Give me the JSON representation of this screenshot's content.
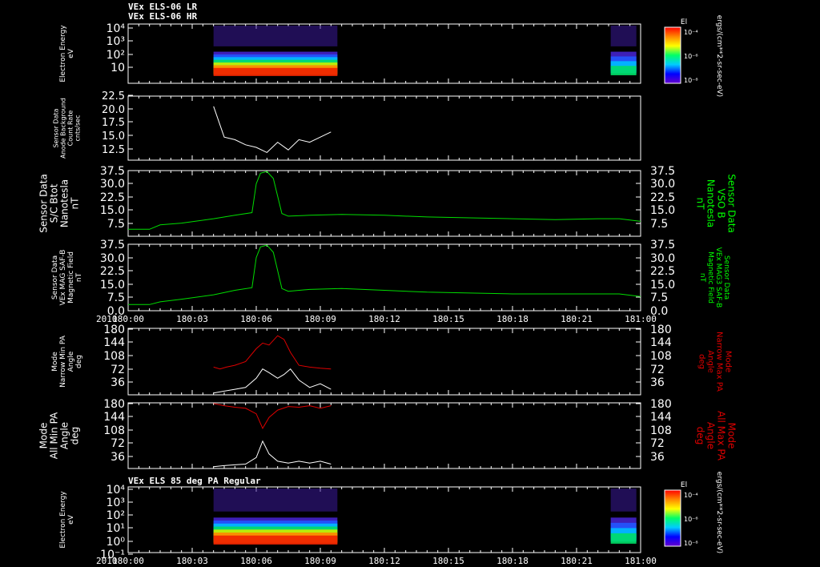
{
  "header": {
    "title_line1": "VEx ELS-06 LR",
    "title_line2": "VEx ELS-06 HR",
    "bottom_title": "VEx ELS 85 deg PA Regular"
  },
  "colors": {
    "background": "#000000",
    "axis": "#ffffff",
    "green": "#00dd00",
    "label_green": "#00ff00",
    "red": "#dd0000",
    "white_trace": "#ffffff"
  },
  "colorbar": {
    "label": "El",
    "ticks": [
      "10⁻⁴",
      "10⁻⁶",
      "10⁻⁸"
    ],
    "unit": "ergs/(cm**2-sr-sec-eV)"
  },
  "time_axis": {
    "year": "2010",
    "ticks": [
      "180:00",
      "180:03",
      "180:06",
      "180:09",
      "180:12",
      "180:15",
      "180:18",
      "180:21",
      "181:00"
    ]
  },
  "chart_data": [
    {
      "type": "heatmap",
      "ylabel": "Electron Energy\neV",
      "y_scale": "log",
      "ylim": [
        1,
        10000
      ],
      "yticks": [
        "10⁴",
        "10³",
        "10²",
        "10"
      ],
      "coverage": [
        [
          "180:04.0",
          "180:09.8"
        ],
        [
          "180:22.6",
          "180:23.8"
        ]
      ]
    },
    {
      "type": "line",
      "ylabel": "Sensor Data\nAnode Background\nCount Rate\ncnts/sec",
      "ylim": [
        10,
        22.5
      ],
      "yticks": [
        "22.5",
        "20.0",
        "17.5",
        "15.0",
        "12.5"
      ],
      "series": [
        {
          "color": "white",
          "x": [
            "180:04.0",
            "180:04.5",
            "180:05.0",
            "180:05.5",
            "180:06.0",
            "180:06.5",
            "180:07.0",
            "180:07.5",
            "180:08.0",
            "180:08.5",
            "180:09.0",
            "180:09.5"
          ],
          "y": [
            20.5,
            14.5,
            14.0,
            13.0,
            12.5,
            11.5,
            13.5,
            12.0,
            14.0,
            13.5,
            14.5,
            15.5
          ]
        }
      ]
    },
    {
      "type": "line",
      "ylabel": "Sensor Data\nS/C Btot\nNanotesla\nnT",
      "ylabel_right": "Sensor Data\nVSO B\nNanotesla\nnT",
      "ylim": [
        0,
        37.5
      ],
      "yticks": [
        "37.5",
        "30.0",
        "22.5",
        "15.0",
        "7.5"
      ],
      "series": [
        {
          "color": "green",
          "x": [
            "180:00.0",
            "180:01.0",
            "180:01.5",
            "180:02.5",
            "180:04.0",
            "180:05.0",
            "180:05.8",
            "180:06.0",
            "180:06.2",
            "180:06.5",
            "180:06.8",
            "180:07.2",
            "180:07.5",
            "180:08.5",
            "180:10.0",
            "180:12.0",
            "180:14.0",
            "180:16.0",
            "180:18.0",
            "180:20.0",
            "180:22.0",
            "180:23.0",
            "180:24.0"
          ],
          "y": [
            4.0,
            4.0,
            6.5,
            7.5,
            10.0,
            12.0,
            13.5,
            30.0,
            36.0,
            37.0,
            33.0,
            13.0,
            11.5,
            12.0,
            12.5,
            12.0,
            11.0,
            10.5,
            10.0,
            9.5,
            10.0,
            10.0,
            8.5
          ]
        }
      ]
    },
    {
      "type": "line",
      "ylabel": "Sensor Data\nVEx MAG SAF-B\nMagnetic Field\nnT",
      "ylabel_right": "Sensor Data\nVEx MAG3 SAF-B\nMagnetic Field\nnT",
      "ylim": [
        0,
        37.5
      ],
      "yticks": [
        "37.5",
        "30.0",
        "22.5",
        "15.0",
        "7.5",
        "0.0"
      ],
      "series": [
        {
          "color": "green",
          "x": [
            "180:00.0",
            "180:01.0",
            "180:01.5",
            "180:02.5",
            "180:04.0",
            "180:05.0",
            "180:05.8",
            "180:06.0",
            "180:06.2",
            "180:06.5",
            "180:06.8",
            "180:07.2",
            "180:07.5",
            "180:08.5",
            "180:10.0",
            "180:12.0",
            "180:14.0",
            "180:16.0",
            "180:18.0",
            "180:20.0",
            "180:22.0",
            "180:23.0",
            "180:24.0"
          ],
          "y": [
            3.5,
            3.5,
            5.0,
            6.5,
            9.0,
            11.5,
            13.0,
            30.0,
            36.0,
            37.0,
            33.0,
            12.5,
            11.0,
            12.0,
            12.5,
            11.5,
            10.5,
            10.0,
            9.5,
            9.5,
            9.5,
            9.5,
            8.0
          ]
        }
      ]
    },
    {
      "type": "line",
      "ylabel": "Mode\nNarrow Min PA\nAngle\ndeg",
      "ylabel_right": "Mode\nNarrow Max PA\nAngle\ndeg",
      "ylim": [
        0,
        180
      ],
      "yticks": [
        "180",
        "144",
        "108",
        "72",
        "36"
      ],
      "series": [
        {
          "color": "red",
          "x": [
            "180:04.0",
            "180:04.3",
            "180:04.6",
            "180:05.0",
            "180:05.5",
            "180:06.0",
            "180:06.3",
            "180:06.6",
            "180:07.0",
            "180:07.3",
            "180:07.6",
            "180:08.0",
            "180:08.5",
            "180:09.0",
            "180:09.5"
          ],
          "y": [
            75,
            70,
            75,
            80,
            90,
            125,
            140,
            135,
            160,
            150,
            115,
            80,
            75,
            72,
            70
          ]
        },
        {
          "color": "white",
          "x": [
            "180:04.0",
            "180:04.5",
            "180:05.0",
            "180:05.5",
            "180:06.0",
            "180:06.3",
            "180:06.6",
            "180:07.0",
            "180:07.3",
            "180:07.6",
            "180:08.0",
            "180:08.5",
            "180:09.0",
            "180:09.5"
          ],
          "y": [
            5,
            10,
            15,
            20,
            45,
            70,
            60,
            45,
            55,
            70,
            40,
            20,
            30,
            15
          ]
        }
      ]
    },
    {
      "type": "line",
      "ylabel": "Mode\nAll Min PA\nAngle\ndeg",
      "ylabel_right": "Mode\nAll Max PA\nAngle\ndeg",
      "ylim": [
        0,
        180
      ],
      "yticks": [
        "180",
        "144",
        "108",
        "72",
        "36"
      ],
      "series": [
        {
          "color": "red",
          "x": [
            "180:04.0",
            "180:04.5",
            "180:05.0",
            "180:05.5",
            "180:06.0",
            "180:06.3",
            "180:06.6",
            "180:07.0",
            "180:07.5",
            "180:08.0",
            "180:08.5",
            "180:09.0",
            "180:09.5"
          ],
          "y": [
            178,
            172,
            168,
            165,
            150,
            110,
            140,
            160,
            170,
            168,
            172,
            165,
            172
          ]
        },
        {
          "color": "white",
          "x": [
            "180:04.0",
            "180:04.5",
            "180:05.0",
            "180:05.5",
            "180:06.0",
            "180:06.3",
            "180:06.6",
            "180:07.0",
            "180:07.5",
            "180:08.0",
            "180:08.5",
            "180:09.0",
            "180:09.5"
          ],
          "y": [
            5,
            8,
            10,
            12,
            30,
            75,
            40,
            20,
            15,
            20,
            15,
            20,
            12
          ]
        }
      ]
    },
    {
      "type": "heatmap",
      "ylabel": "Electron Energy\neV",
      "y_scale": "log",
      "ylim": [
        0.1,
        10000
      ],
      "yticks": [
        "10⁴",
        "10³",
        "10²",
        "10¹",
        "10⁰",
        "10⁻¹"
      ],
      "coverage": [
        [
          "180:04.0",
          "180:09.8"
        ],
        [
          "180:22.6",
          "180:23.8"
        ]
      ]
    }
  ]
}
